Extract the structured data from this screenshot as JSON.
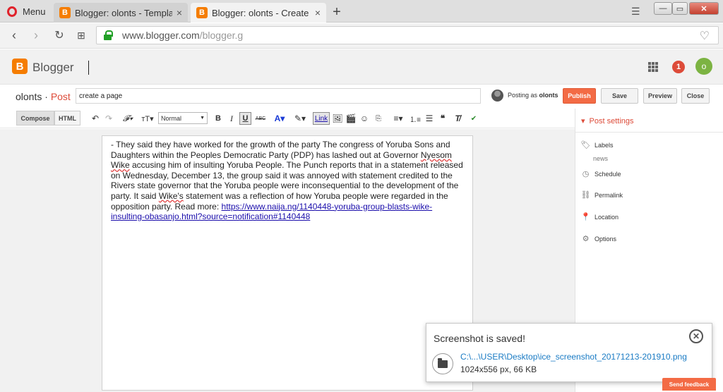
{
  "browser": {
    "menu_label": "Menu",
    "tabs": [
      {
        "title": "Blogger: olonts - Template",
        "active": false
      },
      {
        "title": "Blogger: olonts - Create post",
        "active": true
      }
    ],
    "new_tab": "+",
    "close_glyph": "×",
    "address": {
      "host": "www.blogger.com",
      "path": "/blogger.g"
    }
  },
  "blogger": {
    "logo_letter": "B",
    "app_name": "Blogger",
    "notification_count": "1",
    "avatar_initial": "o"
  },
  "post_bar": {
    "blog_name": "olonts",
    "separator": " · ",
    "section": "Post",
    "title_value": "create a page",
    "posting_as_label": "Posting as",
    "posting_as_user": "olonts",
    "buttons": {
      "publish": "Publish",
      "save": "Save",
      "preview": "Preview",
      "close": "Close"
    }
  },
  "toolbar": {
    "compose": "Compose",
    "html": "HTML",
    "font_size_value": "Normal",
    "link": "Link",
    "bold": "B",
    "italic": "I",
    "underline": "U",
    "strike": "ABC"
  },
  "editor": {
    "text1": "- They said they have worked for the growth of the party The congress of Yoruba Sons and Daughters within the Peoples Democratic Party (PDP) has lashed out at Governor ",
    "squiggle1": "Nyesom Wike",
    "text2": " accusing him of insulting Yoruba People. The Punch reports that in a statement released on Wednesday, December 13, the group said it was annoyed with statement credited to the Rivers state governor that the Yoruba people were inconsequential to the development of the party. It said ",
    "squiggle2": "Wike's",
    "text3": " statement was a reflection of how Yoruba people were regarded in the opposition party. Read more: ",
    "link": "https://www.naija.ng/1140448-yoruba-group-blasts-wike-insulting-obasanjo.html?source=notification#1140448"
  },
  "sidebar": {
    "header": "Post settings",
    "labels": "Labels",
    "labels_value": "news",
    "schedule": "Schedule",
    "permalink": "Permalink",
    "location": "Location",
    "options": "Options"
  },
  "toast": {
    "title": "Screenshot is saved!",
    "path": "C:\\...\\USER\\Desktop\\ice_screenshot_20171213-201910.png",
    "size": "1024x556 px, 66 KB"
  },
  "feedback": "Send feedback",
  "colors": {
    "blogger_orange": "#f57d00",
    "publish": "#f36b45",
    "accent_red": "#dd4b39",
    "avatar_green": "#7cb342"
  }
}
